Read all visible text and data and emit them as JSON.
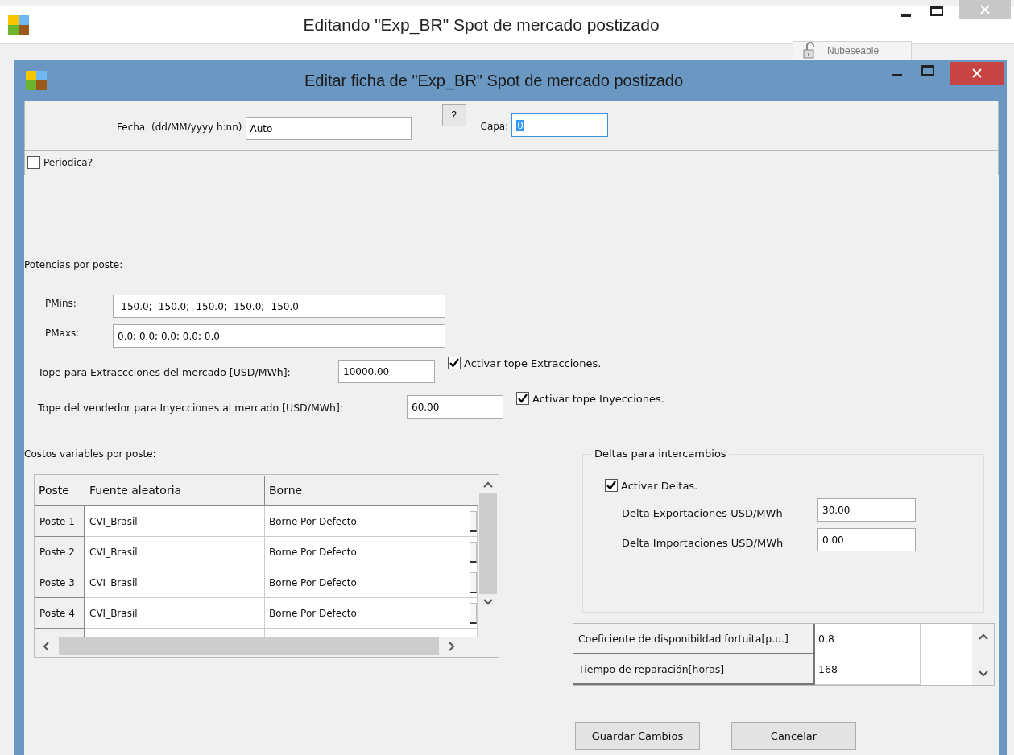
{
  "window": {
    "title": "Editando \"Exp_BR\" Spot de mercado postizado"
  },
  "toolbar_button": {
    "label": "Nubeseable",
    "disabled": true
  },
  "dialog": {
    "title": "Editar ficha de  \"Exp_BR\" Spot de mercado postizado"
  },
  "header": {
    "fecha_label": "Fecha: (dd/MM/yyyy h:nn)",
    "fecha_value": "Auto",
    "help_button": "?",
    "capa_label": "Capa:",
    "capa_value": "0"
  },
  "periodica": {
    "label": "Periodica?",
    "checked": false
  },
  "potencias": {
    "title": "Potencias por poste:",
    "rows": [
      {
        "label": "PMins:",
        "value": "-150.0; -150.0; -150.0; -150.0; -150.0"
      },
      {
        "label": "PMaxs:",
        "value": "0.0; 0.0; 0.0; 0.0; 0.0"
      }
    ]
  },
  "topes": [
    {
      "label": "Tope para Extraccciones del mercado [USD/MWh]:",
      "value": "10000.00",
      "check_label": "Activar tope Extracciones.",
      "checked": true
    },
    {
      "label": "Tope del vendedor para Inyecciones al mercado [USD/MWh]:",
      "value": "60.00",
      "check_label": "Activar tope Inyecciones.",
      "checked": true
    }
  ],
  "costos": {
    "title": "Costos variables por poste:",
    "columns": [
      "Poste",
      "Fuente aleatoria",
      "Borne"
    ],
    "rows": [
      {
        "poste": "Poste 1",
        "fuente": "CVI_Brasil",
        "borne": "Borne Por Defecto"
      },
      {
        "poste": "Poste 2",
        "fuente": "CVI_Brasil",
        "borne": "Borne Por Defecto"
      },
      {
        "poste": "Poste 3",
        "fuente": "CVI_Brasil",
        "borne": "Borne Por Defecto"
      },
      {
        "poste": "Poste 4",
        "fuente": "CVI_Brasil",
        "borne": "Borne Por Defecto"
      }
    ]
  },
  "deltas": {
    "title": "Deltas para intercambios",
    "check": {
      "label": "Activar Deltas.",
      "checked": true
    },
    "fields": [
      {
        "label": "Delta Exportaciones USD/MWh",
        "value": "30.00"
      },
      {
        "label": "Delta Importaciones USD/MWh",
        "value": "0.00"
      }
    ]
  },
  "params": {
    "rows": [
      {
        "label": "Coeficiente de disponibildad fortuita[p.u.]",
        "value": "0.8"
      },
      {
        "label": "Tiempo de reparación[horas]",
        "value": "168"
      }
    ]
  },
  "buttons": [
    "Guardar Cambios",
    "Cancelar"
  ]
}
